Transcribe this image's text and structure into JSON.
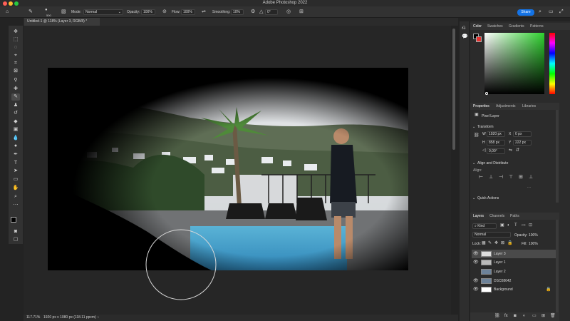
{
  "app": {
    "title": "Adobe Photoshop 2022"
  },
  "options": {
    "mode_label": "Mode:",
    "mode_value": "Normal",
    "opacity_label": "Opacity:",
    "opacity_value": "100%",
    "flow_label": "Flow:",
    "flow_value": "100%",
    "smoothing_label": "Smoothing:",
    "smoothing_value": "10%",
    "angle_value": "0°",
    "brush_size": "500",
    "share_label": "Share"
  },
  "document": {
    "tab_label": "Untitled-1 @ 118% (Layer 3, RGB/8) *"
  },
  "status": {
    "zoom": "117.71%",
    "doc_info": "1920 px x 1080 px (118.11 ppcm)"
  },
  "color_panel": {
    "tabs": [
      "Color",
      "Swatches",
      "Gradients",
      "Patterns"
    ]
  },
  "properties": {
    "tabs": [
      "Properties",
      "Adjustments",
      "Libraries"
    ],
    "pixel_layer": "Pixel Layer",
    "transform_title": "Transform",
    "w_label": "W",
    "w_value": "1920 px",
    "x_label": "X",
    "x_value": "0 px",
    "h_label": "H",
    "h_value": "858 px",
    "y_label": "Y",
    "y_value": "222 px",
    "angle_value": "0,00°",
    "align_title": "Align and Distribute",
    "align_label": "Align:",
    "quick_actions": "Quick Actions"
  },
  "layers_panel": {
    "tabs": [
      "Layers",
      "Channels",
      "Paths"
    ],
    "kind_label": "Kind",
    "blend_mode": "Normal",
    "opacity_label": "Opacity:",
    "opacity_value": "100%",
    "lock_label": "Lock:",
    "fill_label": "Fill:",
    "fill_value": "100%",
    "layers": [
      {
        "name": "Layer 3"
      },
      {
        "name": "Layer 1"
      },
      {
        "name": "Layer 2"
      },
      {
        "name": "DSC08642"
      },
      {
        "name": "Background"
      }
    ]
  },
  "colors": {
    "accent": "#1473e6",
    "foreground": "#000000",
    "background": "#e8312f"
  },
  "icons": [
    "move-icon",
    "marquee-icon",
    "lasso-icon",
    "quick-select-icon",
    "crop-icon",
    "frame-icon",
    "eyedropper-icon",
    "healing-icon",
    "brush-icon",
    "stamp-icon",
    "history-brush-icon",
    "eraser-icon",
    "gradient-icon",
    "blur-icon",
    "dodge-icon",
    "pen-icon",
    "type-icon",
    "path-select-icon",
    "shape-icon",
    "hand-icon",
    "zoom-icon",
    "more-tools-icon"
  ]
}
